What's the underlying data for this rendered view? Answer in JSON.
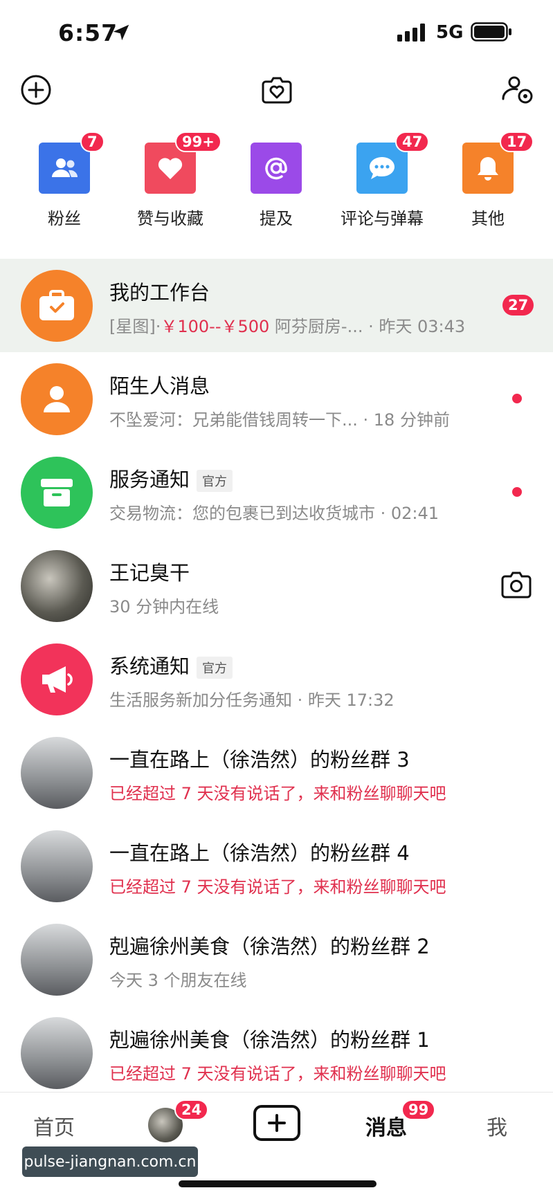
{
  "status": {
    "time": "6:57",
    "network": "5G"
  },
  "topbar": {
    "add_icon": "plus-circle-icon",
    "center_icon": "camera-heart-icon",
    "right_icon": "people-settings-icon"
  },
  "categories": [
    {
      "label": "粉丝",
      "badge": "7",
      "color": "#3b73e8",
      "icon": "people-icon"
    },
    {
      "label": "赞与收藏",
      "badge": "99+",
      "color": "#f04a5e",
      "icon": "heart-icon"
    },
    {
      "label": "提及",
      "badge": "",
      "color": "#9b4ae8",
      "icon": "at-icon"
    },
    {
      "label": "评论与弹幕",
      "badge": "47",
      "color": "#3ba3f0",
      "icon": "chat-bubble-icon"
    },
    {
      "label": "其他",
      "badge": "17",
      "color": "#f5822a",
      "icon": "bell-icon"
    }
  ],
  "messages": [
    {
      "title": "我的工作台",
      "sub_prefix": "[星图]·",
      "sub_price": "￥100--￥500",
      "sub_rest": " 阿芬厨房-... · 昨天 03:43",
      "badge": "27",
      "avatar": "briefcase-icon",
      "avatar_color": "#f5822a"
    },
    {
      "title": "陌生人消息",
      "sub": "不坠爱河：兄弟能借钱周转一下... · 18 分钟前",
      "avatar": "person-icon",
      "avatar_color": "#f5822a"
    },
    {
      "title": "服务通知",
      "tag": "官方",
      "sub": "交易物流：您的包裹已到达收货城市 · 02:41",
      "avatar": "box-icon",
      "avatar_color": "#2ec35a"
    },
    {
      "title": "王记臭干",
      "sub": "30 分钟内在线",
      "avatar": "photo-avatar"
    },
    {
      "title": "系统通知",
      "tag": "官方",
      "sub": "生活服务新加分任务通知 · 昨天 17:32",
      "avatar": "megaphone-icon",
      "avatar_color": "#f2335a"
    },
    {
      "title": "一直在路上（徐浩然）的粉丝群 3",
      "sub": "已经超过 7 天没有说话了，来和粉丝聊聊天吧",
      "avatar": "photo-avatar"
    },
    {
      "title": "一直在路上（徐浩然）的粉丝群 4",
      "sub": "已经超过 7 天没有说话了，来和粉丝聊聊天吧",
      "avatar": "photo-avatar"
    },
    {
      "title": "剋遍徐州美食（徐浩然）的粉丝群 2",
      "sub": "今天 3 个朋友在线",
      "avatar": "photo-avatar"
    },
    {
      "title": "剋遍徐州美食（徐浩然）的粉丝群 1",
      "sub": "已经超过 7 天没有说话了，来和粉丝聊聊天吧",
      "avatar": "photo-avatar"
    }
  ],
  "tabbar": {
    "home": "首页",
    "friends_badge": "24",
    "messages": "消息",
    "messages_badge": "99",
    "me": "我"
  },
  "watermark": "pulse-jiangnan.com.cn"
}
